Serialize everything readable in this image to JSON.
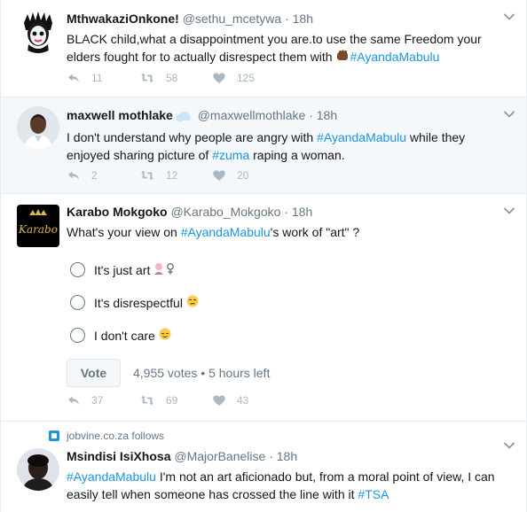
{
  "tweets": [
    {
      "name": "MthwakaziOnkone!",
      "handle": "@sethu_mcetywa",
      "dot": "·",
      "time": "18h",
      "text_1": "BLACK child,what a disappointment you are.to use the same Freedom your",
      "text_2a": "elders fought for to actually disrespect them with ",
      "text_2b": "#AyandaMabulu",
      "replies": "11",
      "retweets": "58",
      "likes": "125"
    },
    {
      "name": "maxwell mothlake",
      "handle": "@maxwellmothlake",
      "dot": "·",
      "time": "18h",
      "text_1a": "I don't understand why people are angry with ",
      "text_1b": "#AyandaMabulu",
      "text_1c": " while they",
      "text_2a": "enjoyed sharing picture of ",
      "text_2b": "#zuma",
      "text_2c": " raping a woman.",
      "replies": "2",
      "retweets": "12",
      "likes": "20"
    },
    {
      "name": "Karabo Mokgoko",
      "handle": "@Karabo_Mokgoko",
      "dot": "·",
      "time": "18h",
      "text_a": "What's your view on ",
      "text_b": "#AyandaMabulu",
      "text_c": "'s work of \"art\" ?",
      "avatar_text": "Karabo",
      "poll_options": [
        "It's just art",
        "It's disrespectful",
        "I don't care"
      ],
      "vote_label": "Vote",
      "votes": "4,955 votes",
      "bullet": "•",
      "time_left": "5 hours left",
      "replies": "37",
      "retweets": "69",
      "likes": "43"
    },
    {
      "follows": "jobvine.co.za follows",
      "name": "Msindisi IsiXhosa",
      "handle": "@MajorBanelise",
      "dot": "·",
      "time": "18h",
      "text_1a": "#AyandaMabulu",
      "text_1b": " I'm not an art aficionado but, from a moral point of view, I can",
      "text_2a": "easily tell when someone has crossed the line with it ",
      "text_2b": "#TSA"
    }
  ],
  "colors": {
    "link": "#1b95e0",
    "muted": "#657786",
    "icon": "#aab8c2",
    "highlight_bg": "#f5f8fa"
  }
}
